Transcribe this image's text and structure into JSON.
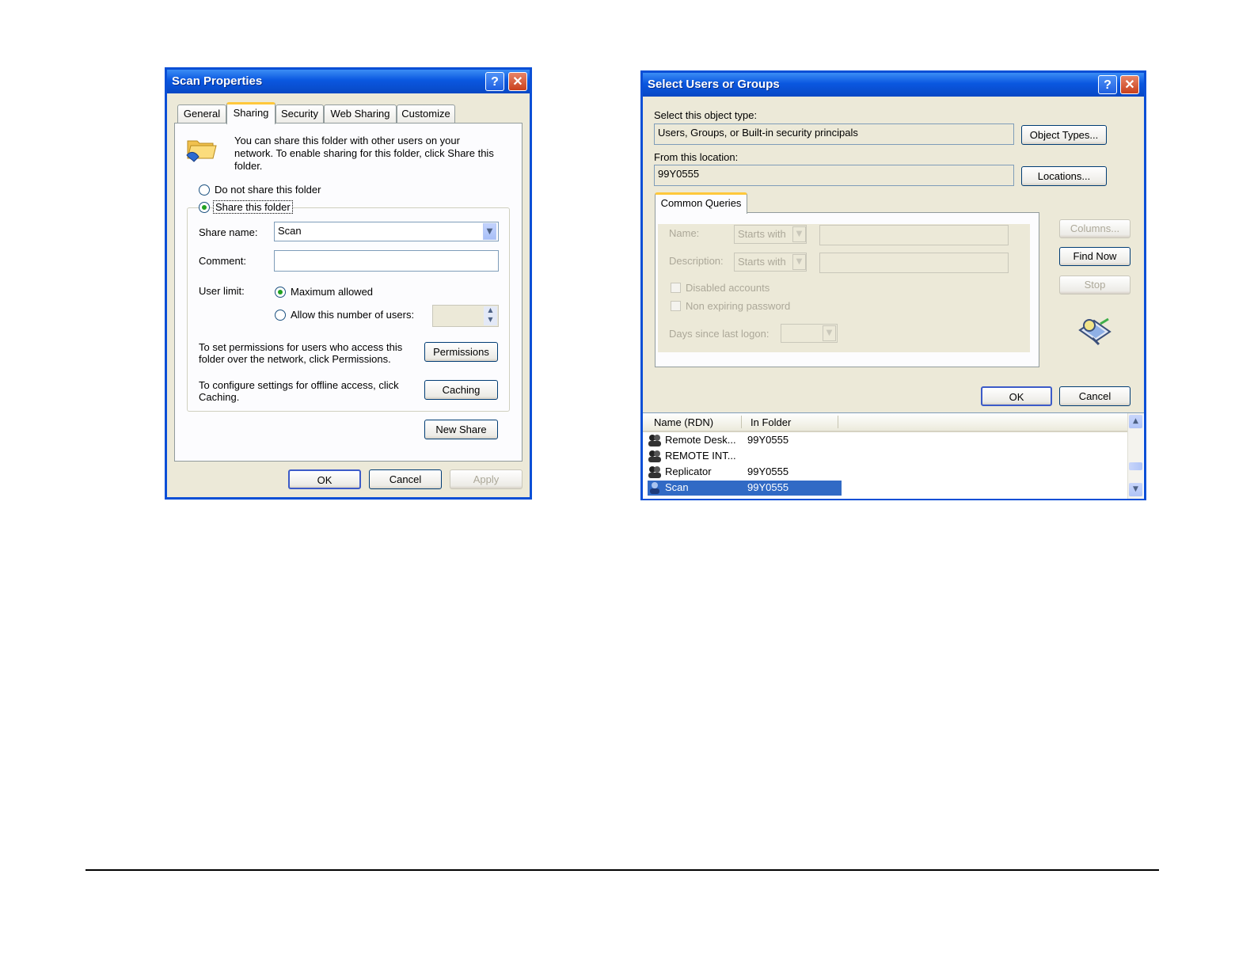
{
  "scan_properties": {
    "title": "Scan Properties",
    "tabs": [
      "General",
      "Sharing",
      "Security",
      "Web Sharing",
      "Customize"
    ],
    "active_tab": "Sharing",
    "intro_text_1": "You can share this folder with other users on your",
    "intro_text_2": "network.  To enable sharing for this folder, click Share this",
    "intro_text_3": "folder.",
    "radio_do_not_share": "Do not share this folder",
    "radio_share": "Share this folder",
    "share_name_label": "Share name:",
    "share_name_value": "Scan",
    "comment_label": "Comment:",
    "comment_value": "",
    "user_limit_label": "User limit:",
    "max_allowed_label": "Maximum allowed",
    "allow_number_label": "Allow this number of users:",
    "user_count_value": "",
    "permissions_text_1": "To set permissions for users who access this",
    "permissions_text_2": "folder over the network, click Permissions.",
    "permissions_button": "Permissions",
    "caching_text_1": "To configure settings for offline access, click",
    "caching_text_2": "Caching.",
    "caching_button": "Caching",
    "new_share_button": "New Share",
    "ok_button": "OK",
    "cancel_button": "Cancel",
    "apply_button": "Apply"
  },
  "select_users": {
    "title": "Select Users or Groups",
    "object_type_label": "Select this object type:",
    "object_type_value": "Users, Groups, or Built-in security principals",
    "object_types_button": "Object Types...",
    "location_label": "From this location:",
    "location_value": "99Y0555",
    "locations_button": "Locations...",
    "tab_common_queries": "Common Queries",
    "name_label": "Name:",
    "description_label": "Description:",
    "starts_with": "Starts with",
    "disabled_accounts": "Disabled accounts",
    "non_expiring_password": "Non expiring password",
    "days_since_logon": "Days since last logon:",
    "columns_button": "Columns...",
    "find_now_button": "Find Now",
    "stop_button": "Stop",
    "ok_button": "OK",
    "cancel_button": "Cancel",
    "columns": [
      "Name (RDN)",
      "In Folder"
    ],
    "rows": [
      {
        "name": "Remote Desk...",
        "folder": "99Y0555"
      },
      {
        "name": "REMOTE INT...",
        "folder": ""
      },
      {
        "name": "Replicator",
        "folder": "99Y0555"
      },
      {
        "name": "Scan",
        "folder": "99Y0555"
      }
    ]
  },
  "colors": {
    "titlebar": "#0a57e0",
    "dialog_bg": "#ece9d8",
    "selection": "#316ac5",
    "tab_highlight": "#ffc83c"
  }
}
